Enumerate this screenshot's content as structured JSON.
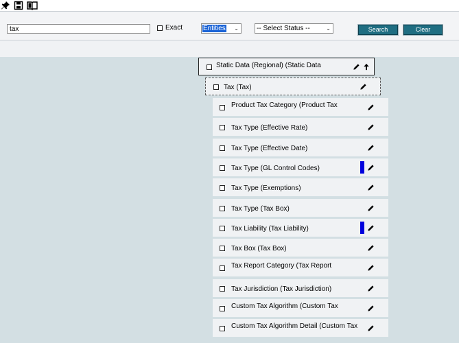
{
  "toolbar": {
    "icons": [
      "pin-icon",
      "save-icon",
      "book-icon"
    ]
  },
  "search": {
    "query": "tax",
    "exact_label": "Exact",
    "type_select": "Entities",
    "status_select": "-- Select Status --",
    "search_button": "Search",
    "clear_button": "Clear"
  },
  "tree": {
    "root": {
      "label": "Static Data (Regional) (Static Data"
    },
    "parent": {
      "label": "Tax (Tax)"
    },
    "items": [
      {
        "label": "Product Tax Category (Product Tax",
        "marker": false
      },
      {
        "label": "Tax Type (Effective Rate)",
        "marker": false
      },
      {
        "label": "Tax Type (Effective Date)",
        "marker": false
      },
      {
        "label": "Tax Type (GL Control Codes)",
        "marker": true
      },
      {
        "label": "Tax Type (Exemptions)",
        "marker": false
      },
      {
        "label": "Tax Type (Tax Box)",
        "marker": false
      },
      {
        "label": "Tax Liability (Tax Liability)",
        "marker": true
      },
      {
        "label": "Tax Box (Tax Box)",
        "marker": false
      },
      {
        "label": "Tax Report Category (Tax Report",
        "marker": false
      },
      {
        "label": "Tax Jurisdiction (Tax Jurisdiction)",
        "marker": false
      },
      {
        "label": "Custom Tax Algorithm (Custom Tax",
        "marker": false
      },
      {
        "label": "Custom Tax Algorithm Detail (Custom Tax",
        "marker": false
      }
    ],
    "colors": {
      "marker": "#0000dd",
      "node_bg": "#f0f2f4",
      "canvas_bg": "#d3dfe3",
      "button_bg": "#1f6e82"
    }
  }
}
